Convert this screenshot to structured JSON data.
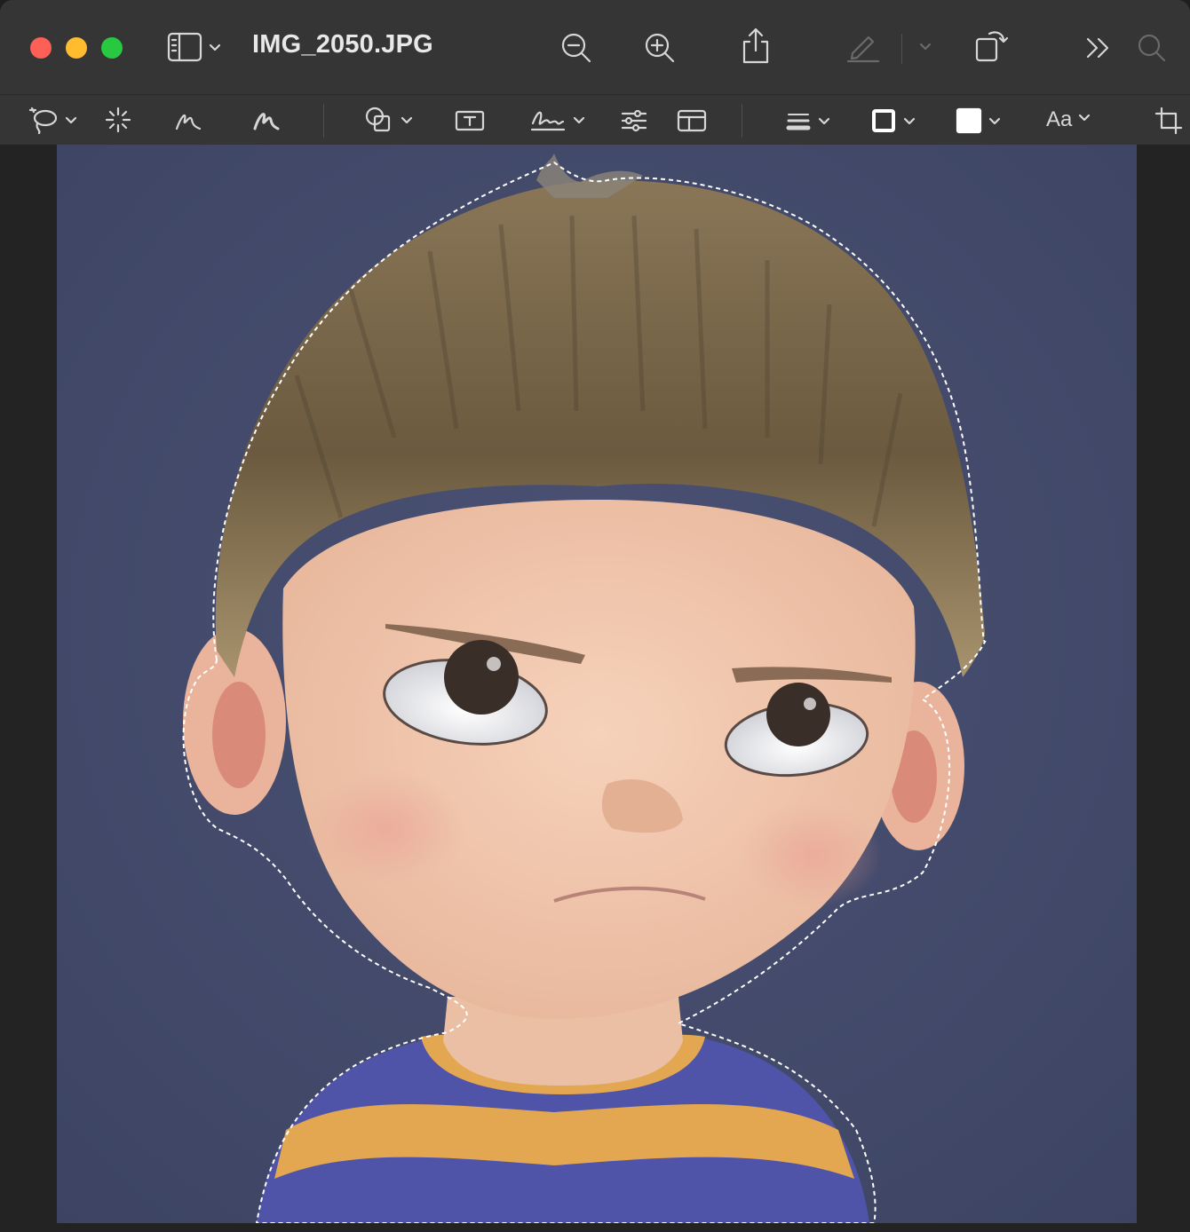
{
  "window": {
    "title": "IMG_2050.JPG"
  },
  "titlebar_buttons": [
    {
      "name": "sidebar-toggle",
      "icon": "sidebar-icon",
      "has_menu": true
    },
    {
      "name": "zoom-out",
      "icon": "zoom-out-icon"
    },
    {
      "name": "zoom-in",
      "icon": "zoom-in-icon"
    },
    {
      "name": "share",
      "icon": "share-icon"
    },
    {
      "name": "markup",
      "icon": "pencil-icon",
      "enabled": false
    },
    {
      "name": "rotate",
      "icon": "rotate-icon"
    },
    {
      "name": "more",
      "icon": "chevron-double-right-icon"
    },
    {
      "name": "search",
      "icon": "search-icon",
      "enabled": false
    }
  ],
  "markup_toolbar": {
    "tools": [
      "smart-lasso-icon",
      "instant-alpha-icon",
      "sketch-icon",
      "draw-icon",
      "shapes-icon",
      "text-box-icon",
      "signature-icon",
      "adjust-color-icon",
      "page-layout-icon",
      "line-style-icon",
      "border-color-icon",
      "fill-color-icon",
      "text-style-icon",
      "crop-icon"
    ],
    "text_style_label": "Aa",
    "border_color": "#ffffff",
    "fill_color": "#ffffff"
  },
  "colors": {
    "chrome": "#353536",
    "image_background": "#42496a",
    "hair": "#6b5a3f",
    "skin": "#f0c6ad",
    "shirt_blue": "#4f54a8",
    "shirt_yellow": "#e3a751"
  }
}
